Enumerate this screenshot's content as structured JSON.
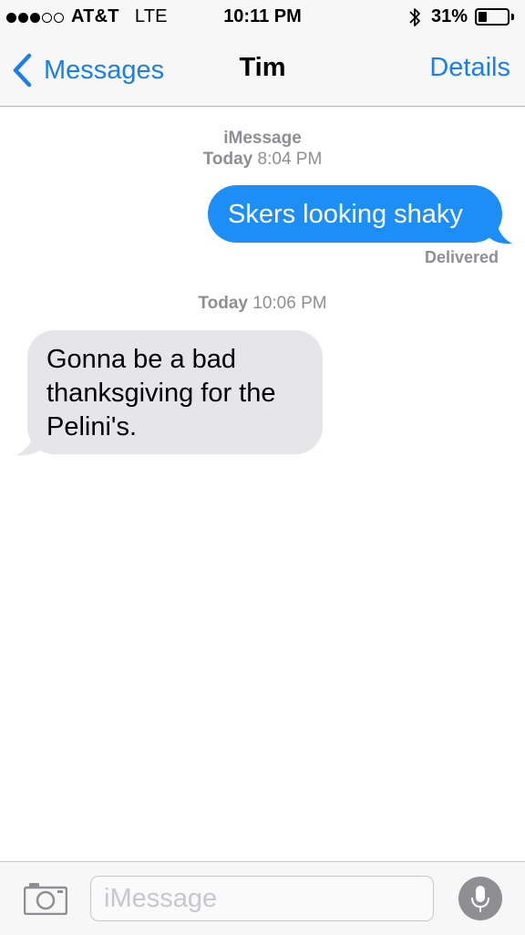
{
  "status_bar": {
    "carrier": "AT&T",
    "network": "LTE",
    "time": "10:11 PM",
    "battery_percent": "31%",
    "battery_level": 0.31,
    "signal_bars": 3,
    "signal_total": 5,
    "icons": [
      "signal-dots-icon",
      "bluetooth-icon",
      "battery-icon"
    ]
  },
  "nav": {
    "back_label": "Messages",
    "title": "Tim",
    "details_label": "Details",
    "icons": [
      "chevron-left-icon"
    ]
  },
  "thread": {
    "service_label": "iMessage",
    "first_timestamp": {
      "day": "Today",
      "time": "8:04 PM"
    },
    "outgoing_message": "Skers looking shaky",
    "delivery_status": "Delivered",
    "second_timestamp": {
      "day": "Today",
      "time": "10:06 PM"
    },
    "incoming_message_lines": [
      "Gonna be a bad",
      "thanksgiving for the",
      "Pelini's."
    ]
  },
  "composer": {
    "placeholder": "iMessage",
    "value": "",
    "icons": [
      "camera-icon",
      "microphone-icon"
    ]
  },
  "colors": {
    "accent": "#1a80e5",
    "outgoing_bubble": "#1d8ef5",
    "incoming_bubble": "#e5e5ea",
    "meta_text": "#8e8e93"
  }
}
